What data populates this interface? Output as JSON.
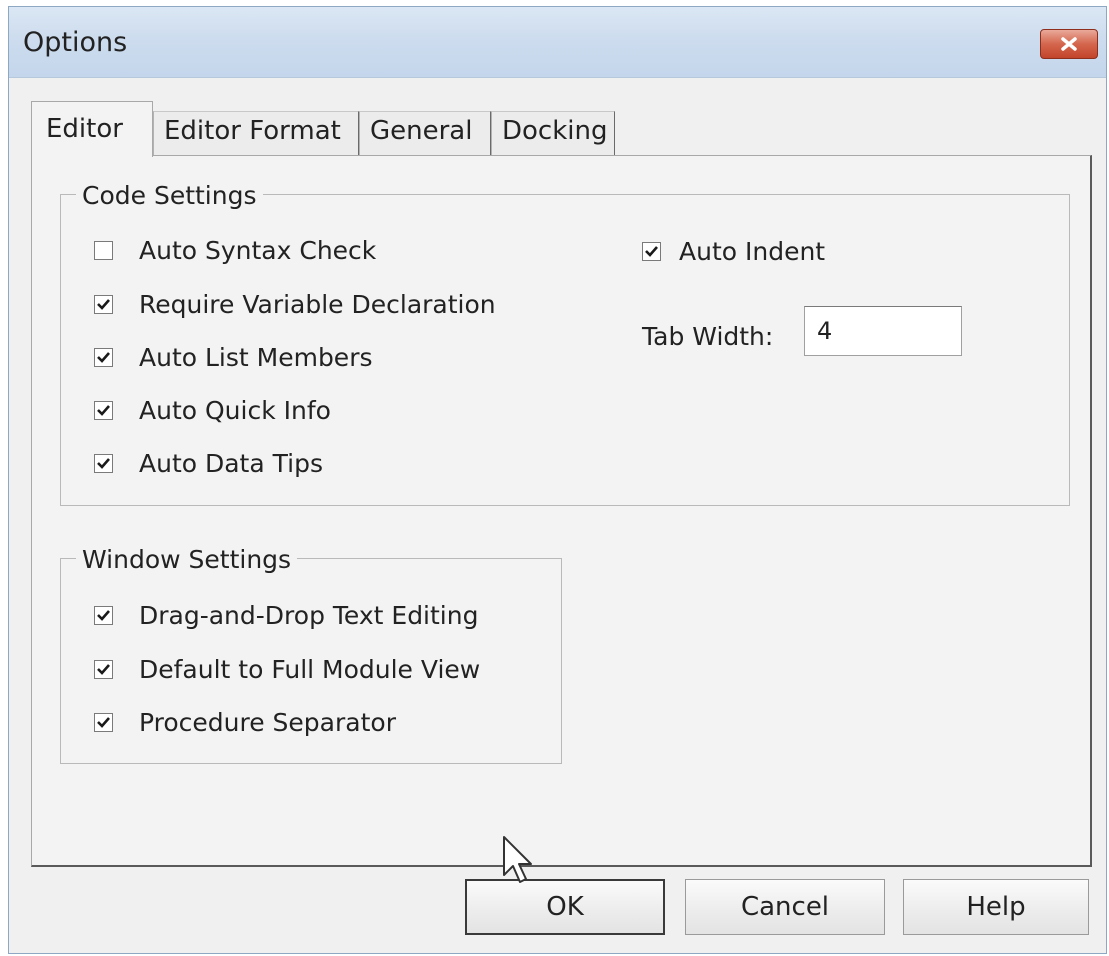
{
  "window": {
    "title": "Options",
    "close_icon": "close-icon"
  },
  "tabs": [
    {
      "label": "Editor",
      "active": true
    },
    {
      "label": "Editor Format",
      "active": false
    },
    {
      "label": "General",
      "active": false
    },
    {
      "label": "Docking",
      "active": false
    }
  ],
  "code_settings": {
    "title": "Code Settings",
    "options": [
      {
        "label": "Auto Syntax Check",
        "checked": false
      },
      {
        "label": "Require Variable Declaration",
        "checked": true
      },
      {
        "label": "Auto List Members",
        "checked": true
      },
      {
        "label": "Auto Quick Info",
        "checked": true
      },
      {
        "label": "Auto Data Tips",
        "checked": true
      }
    ],
    "auto_indent": {
      "label": "Auto Indent",
      "checked": true
    },
    "tab_width": {
      "label": "Tab Width:",
      "value": "4"
    }
  },
  "window_settings": {
    "title": "Window Settings",
    "options": [
      {
        "label": "Drag-and-Drop Text Editing",
        "checked": true
      },
      {
        "label": "Default to Full Module View",
        "checked": true
      },
      {
        "label": "Procedure Separator",
        "checked": true
      }
    ]
  },
  "buttons": {
    "ok": "OK",
    "cancel": "Cancel",
    "help": "Help"
  },
  "colors": {
    "close_button": "#d4664d",
    "titlebar": "#cddcee",
    "dialog_background": "#f0f0f0"
  }
}
